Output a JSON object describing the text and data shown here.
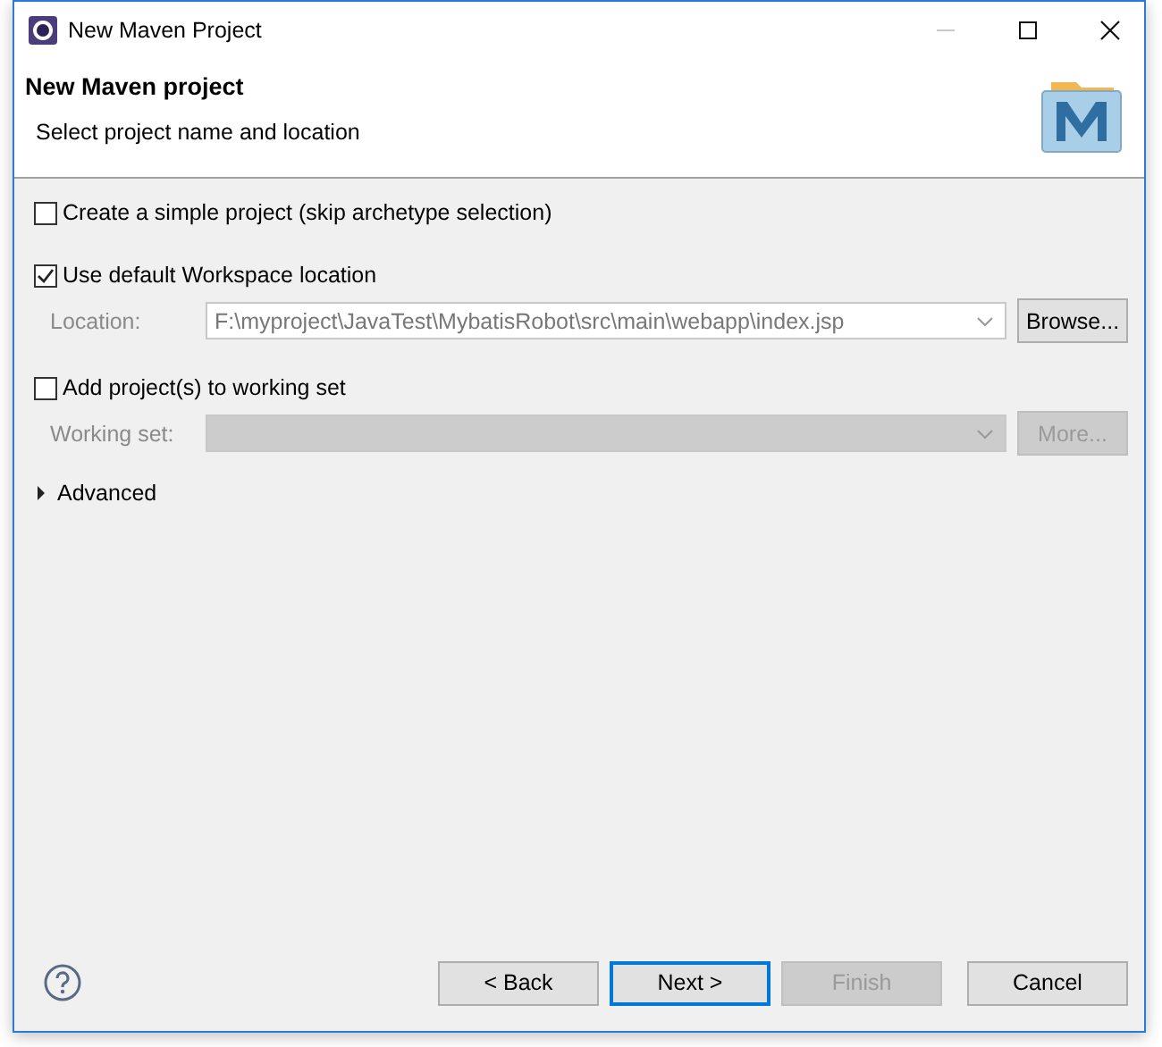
{
  "window": {
    "title": "New Maven Project"
  },
  "header": {
    "title": "New Maven project",
    "subtitle": "Select project name and location"
  },
  "simple_project": {
    "label": "Create a simple project (skip archetype selection)",
    "checked": false
  },
  "default_location": {
    "label": "Use default Workspace location",
    "checked": true
  },
  "location": {
    "label": "Location:",
    "value": "F:\\myproject\\JavaTest\\MybatisRobot\\src\\main\\webapp\\index.jsp",
    "disabled": true
  },
  "browse_button": {
    "label": "Browse...",
    "disabled": false
  },
  "working_set_toggle": {
    "label": "Add project(s) to working set",
    "checked": false
  },
  "working_set": {
    "label": "Working set:",
    "disabled": true
  },
  "more_button": {
    "label": "More...",
    "disabled": true
  },
  "advanced": {
    "label": "Advanced",
    "expanded": false
  },
  "buttons": [
    {
      "label": "< Back",
      "disabled": false,
      "default": false
    },
    {
      "label": "Next >",
      "disabled": false,
      "default": true
    },
    {
      "label": "Finish",
      "disabled": true,
      "default": false
    },
    {
      "label": "Cancel",
      "disabled": false,
      "default": false
    }
  ]
}
